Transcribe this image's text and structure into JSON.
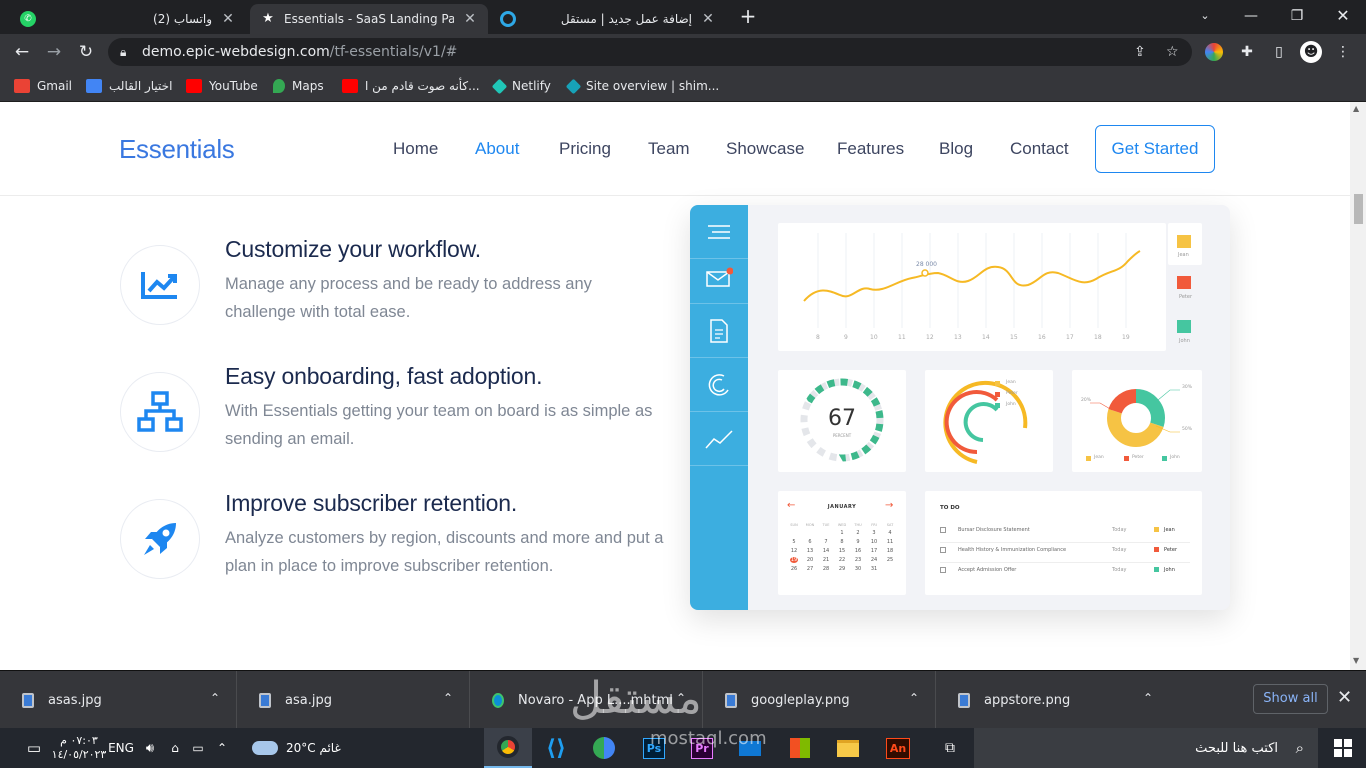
{
  "browser": {
    "tabs": [
      {
        "title": "(2) واتساب",
        "icon": "whatsapp-icon",
        "color": "#25d366"
      },
      {
        "title": "Essentials - SaaS Landing Page Te",
        "icon": "star-icon",
        "color": "#ffffff"
      },
      {
        "title": "إضافة عمل جديد | مستقل",
        "icon": "mostaql-icon",
        "color": "#2ea8e6"
      }
    ],
    "url_domain": "demo.epic-webdesign.com",
    "url_path": "/tf-essentials/v1/#",
    "bookmarks": [
      {
        "label": "Gmail",
        "color": "#ea4335"
      },
      {
        "label": "اختيار القالب",
        "color": "#4285f4"
      },
      {
        "label": "YouTube",
        "color": "#ff0000"
      },
      {
        "label": "Maps",
        "color": "#34a853"
      },
      {
        "label": "كأنه صوت قادم من ا...",
        "color": "#ff0000"
      },
      {
        "label": "Netlify",
        "color": "#20c6b7"
      },
      {
        "label": "Site overview | shim...",
        "color": "#17a2b8"
      }
    ]
  },
  "site": {
    "logo": "Essentials",
    "nav": [
      "Home",
      "About",
      "Pricing",
      "Team",
      "Showcase",
      "Features",
      "Blog",
      "Contact"
    ],
    "active_nav": "About",
    "cta": "Get Started",
    "accent": "#1e87f0",
    "features": [
      {
        "title": "Customize your workflow.",
        "text": "Manage any process and be ready to address any challenge with total ease.",
        "icon": "chart-trend-icon"
      },
      {
        "title": "Easy onboarding, fast adoption.",
        "text": "With Essentials getting your team on board is as simple as sending an email.",
        "icon": "network-icon"
      },
      {
        "title": "Improve subscriber retention.",
        "text": "Analyze customers by region, discounts and more and put a plan in place to improve subscriber retention.",
        "icon": "rocket-icon"
      }
    ]
  },
  "dashboard": {
    "line_peak_label": "28 000",
    "x_ticks": [
      "8",
      "9",
      "10",
      "11",
      "12",
      "13",
      "14",
      "15",
      "16",
      "17",
      "18",
      "19"
    ],
    "legend": [
      "Jean",
      "Peter",
      "John"
    ],
    "gauge_value": "67",
    "gauge_caption": "PERCENT",
    "donut_labels": [
      "30%",
      "20%",
      "50%"
    ],
    "calendar": {
      "month": "JANUARY",
      "weekdays": [
        "SUN",
        "MON",
        "TUE",
        "WED",
        "THU",
        "FRI",
        "SAT"
      ],
      "days": [
        "1",
        "2",
        "3",
        "4",
        "5",
        "6",
        "7",
        "8",
        "9",
        "10",
        "11",
        "12",
        "13",
        "14",
        "15",
        "16",
        "17",
        "18",
        "19",
        "20",
        "21",
        "22",
        "23",
        "24",
        "25",
        "26",
        "27",
        "28",
        "29",
        "30",
        "31"
      ],
      "highlight": "19"
    },
    "todo": {
      "title": "TO DO",
      "items": [
        {
          "task": "Bursar Disclosure Statement",
          "when": "Today",
          "who": "Jean",
          "color": "#f6c344"
        },
        {
          "task": "Health History & Immunization Compliance",
          "when": "Today",
          "who": "Peter",
          "color": "#f15a3b"
        },
        {
          "task": "Accept Admission Offer",
          "when": "Today",
          "who": "John",
          "color": "#45c6a0"
        }
      ]
    }
  },
  "downloads": {
    "items": [
      "asas.jpg",
      "asa.jpg",
      "Novaro - App L....mhtml",
      "googleplay.png",
      "appstore.png"
    ],
    "show_all": "Show all"
  },
  "taskbar": {
    "time": "٠٧:٠٣ م",
    "date": "١٤/٠٥/٢٠٢٣",
    "lang": "ENG",
    "weather": "20°C غائم",
    "search_placeholder": "اكتب هنا للبحث"
  },
  "watermark": {
    "arabic": "مستقل",
    "latin": "mostaql.com"
  }
}
